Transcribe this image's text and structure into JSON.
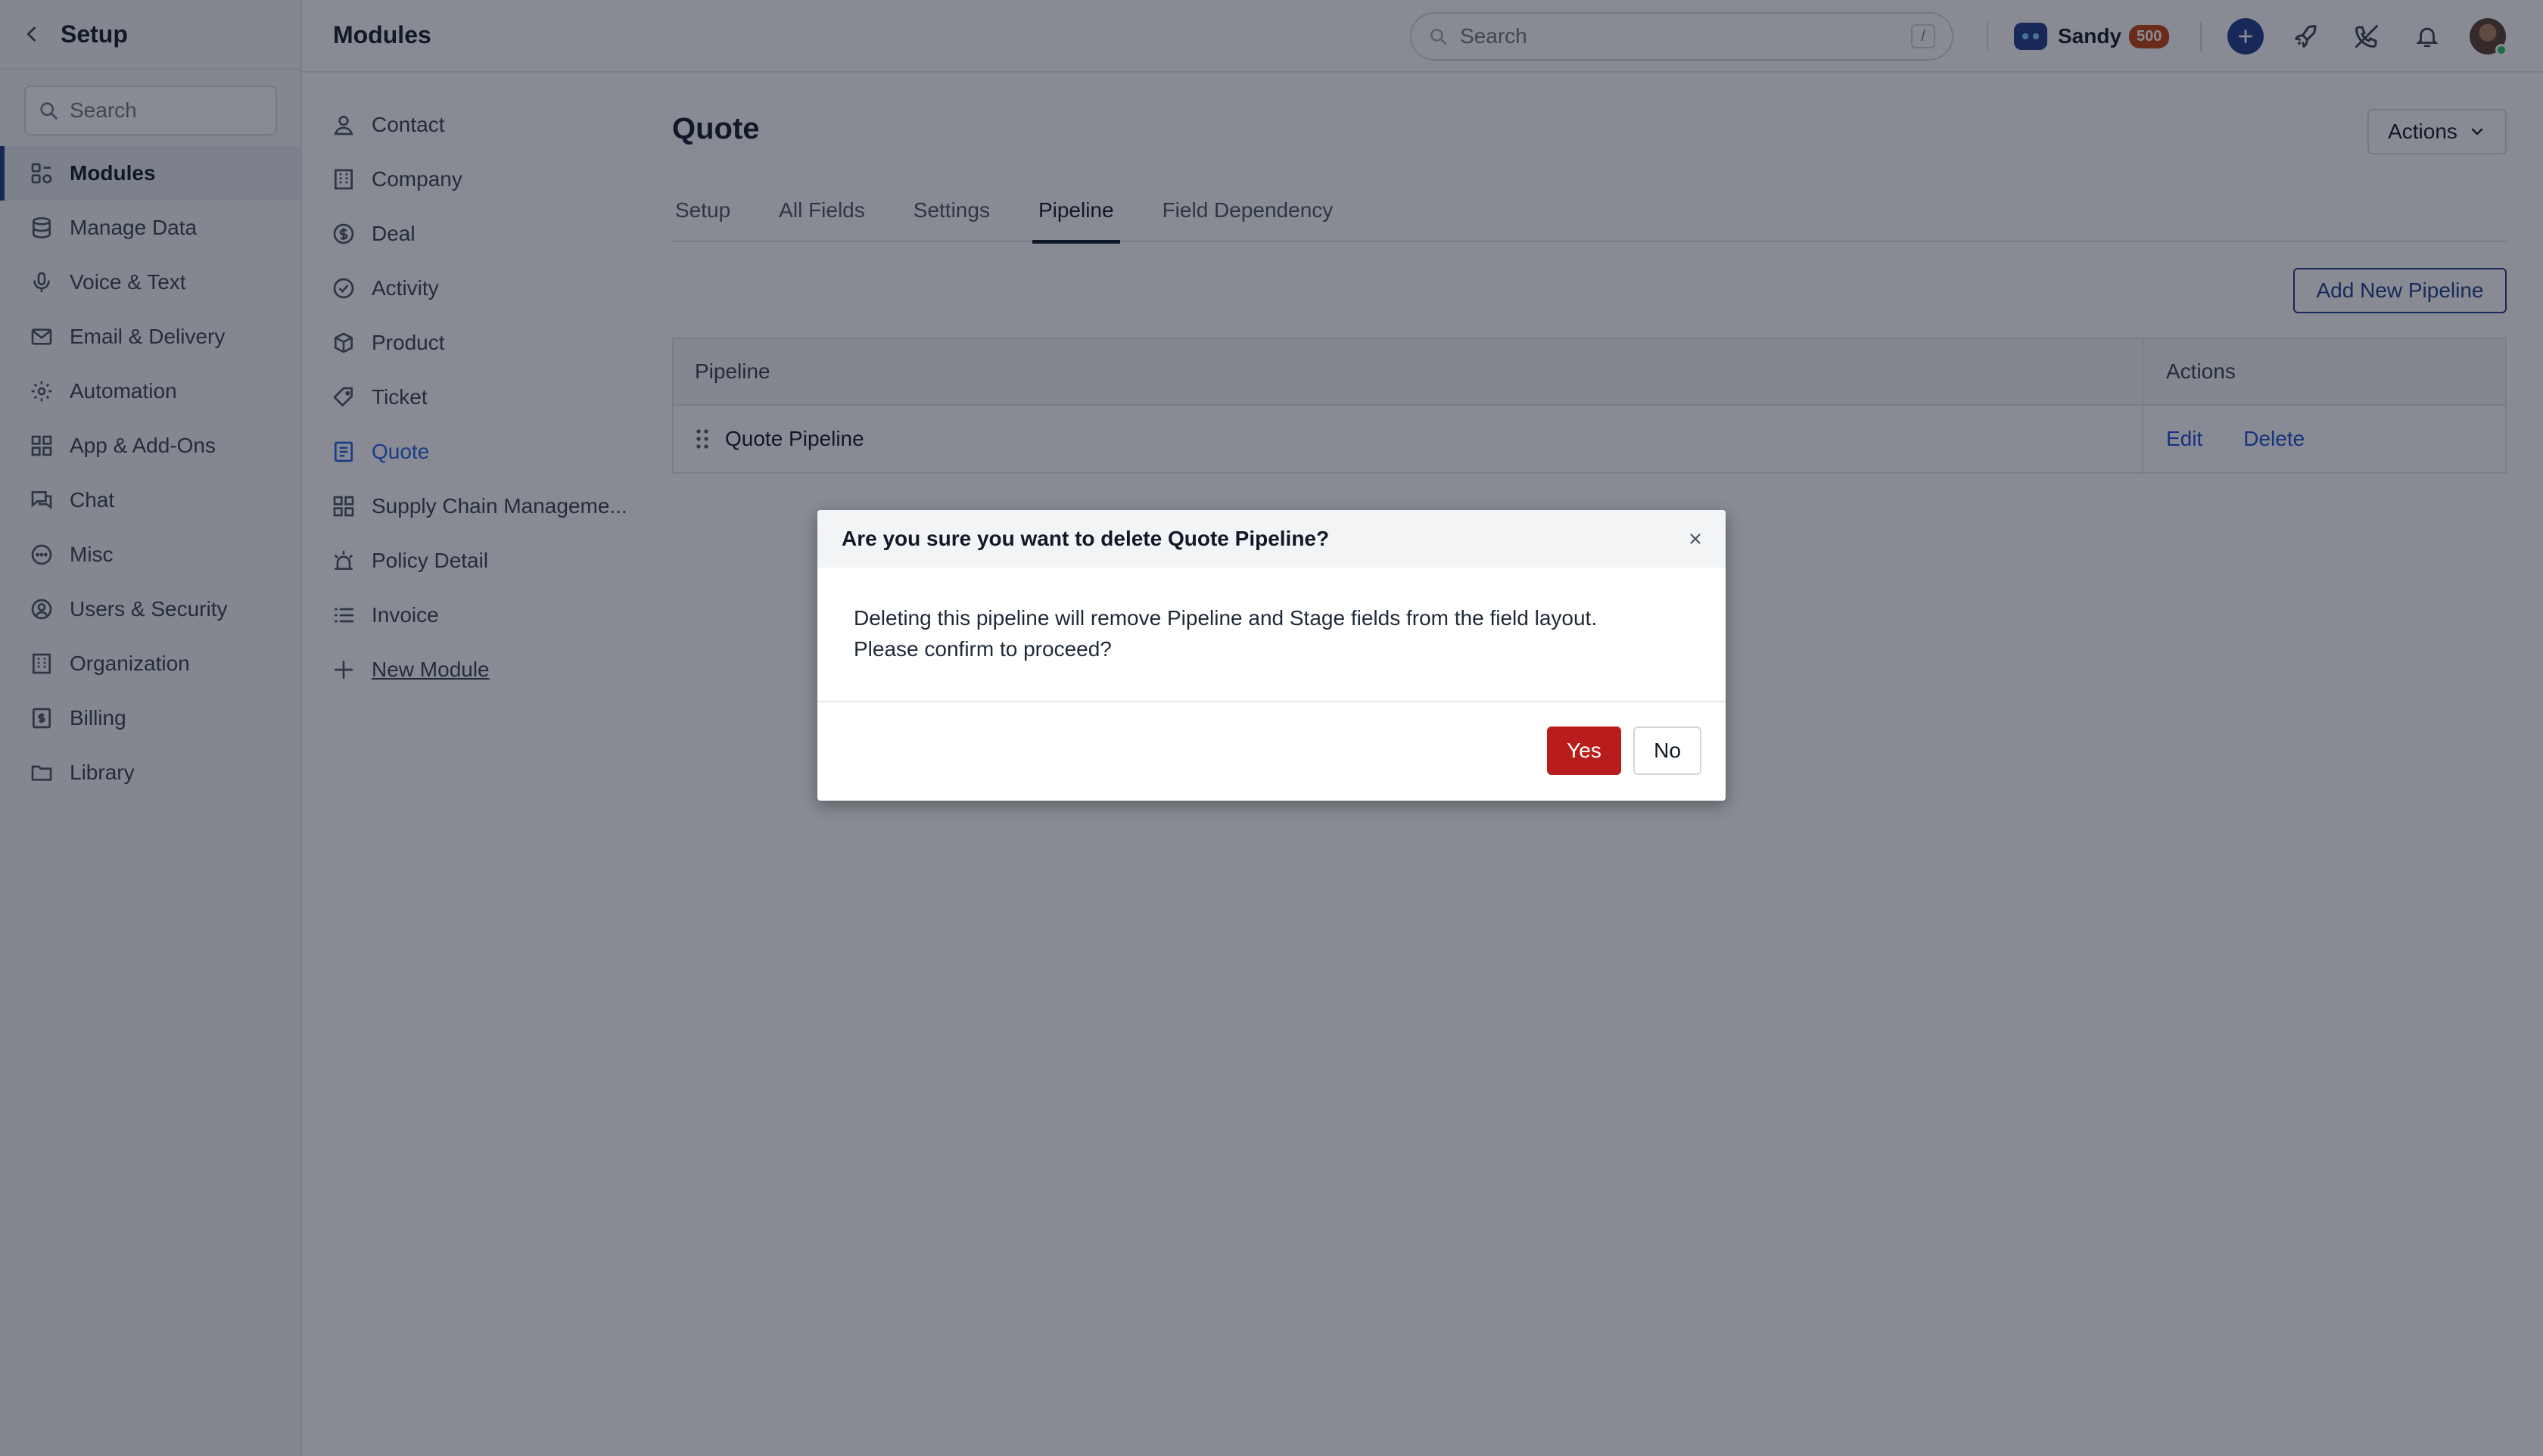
{
  "sidebar": {
    "title": "Setup",
    "search_placeholder": "Search",
    "items": [
      {
        "label": "Modules",
        "icon": "modules-icon"
      },
      {
        "label": "Manage Data",
        "icon": "database-icon"
      },
      {
        "label": "Voice & Text",
        "icon": "microphone-icon"
      },
      {
        "label": "Email & Delivery",
        "icon": "mail-icon"
      },
      {
        "label": "Automation",
        "icon": "automation-icon"
      },
      {
        "label": "App & Add-Ons",
        "icon": "apps-icon"
      },
      {
        "label": "Chat",
        "icon": "chat-icon"
      },
      {
        "label": "Misc",
        "icon": "more-circle-icon"
      },
      {
        "label": "Users & Security",
        "icon": "user-circle-icon"
      },
      {
        "label": "Organization",
        "icon": "building-icon"
      },
      {
        "label": "Billing",
        "icon": "billing-icon"
      },
      {
        "label": "Library",
        "icon": "folder-icon"
      }
    ]
  },
  "header": {
    "title": "Modules",
    "search_placeholder": "Search",
    "search_shortcut": "/",
    "user_name": "Sandy",
    "user_badge": "500"
  },
  "modules": {
    "items": [
      {
        "label": "Contact"
      },
      {
        "label": "Company"
      },
      {
        "label": "Deal"
      },
      {
        "label": "Activity"
      },
      {
        "label": "Product"
      },
      {
        "label": "Ticket"
      },
      {
        "label": "Quote"
      },
      {
        "label": "Supply Chain Manageme..."
      },
      {
        "label": "Policy Detail"
      },
      {
        "label": "Invoice"
      },
      {
        "label": "New Module"
      }
    ]
  },
  "main": {
    "title": "Quote",
    "actions_label": "Actions",
    "tabs": [
      {
        "label": "Setup"
      },
      {
        "label": "All Fields"
      },
      {
        "label": "Settings"
      },
      {
        "label": "Pipeline"
      },
      {
        "label": "Field Dependency"
      }
    ],
    "add_pipeline_label": "Add New Pipeline",
    "table": {
      "headers": [
        "Pipeline",
        "Actions"
      ],
      "rows": [
        {
          "name": "Quote Pipeline",
          "edit": "Edit",
          "delete": "Delete"
        }
      ]
    }
  },
  "modal": {
    "title": "Are you sure you want to delete Quote Pipeline?",
    "body_line1": "Deleting this pipeline will remove Pipeline and Stage fields from the field layout.",
    "body_line2": "Please confirm to proceed?",
    "yes_label": "Yes",
    "no_label": "No"
  },
  "colors": {
    "accent": "#1e3a8a",
    "link": "#1d4ed8",
    "danger": "#b91c1c",
    "badge": "#c2410c"
  }
}
